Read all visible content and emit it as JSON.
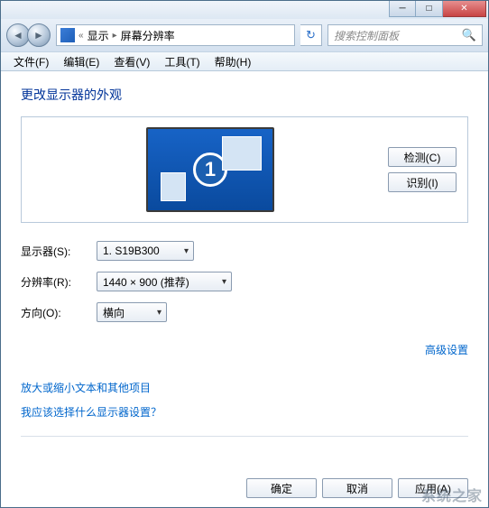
{
  "titlebar": {
    "min": "─",
    "max": "□",
    "close": "✕"
  },
  "nav": {
    "back": "◄",
    "forward": "►",
    "breadcrumb_dbl_chev": "«",
    "breadcrumb_item1": "显示",
    "breadcrumb_item2": "屏幕分辨率",
    "breadcrumb_sep": "▸",
    "refresh": "↻",
    "search_placeholder": "搜索控制面板",
    "search_icon": "🔍"
  },
  "menu": {
    "file": "文件(F)",
    "edit": "编辑(E)",
    "view": "查看(V)",
    "tools": "工具(T)",
    "help": "帮助(H)"
  },
  "page": {
    "title": "更改显示器的外观",
    "monitor_number": "1",
    "detect_btn": "检测(C)",
    "identify_btn": "识别(I)"
  },
  "form": {
    "display_label": "显示器(S):",
    "display_value": "1. S19B300",
    "resolution_label": "分辨率(R):",
    "resolution_value": "1440 × 900 (推荐)",
    "orientation_label": "方向(O):",
    "orientation_value": "横向"
  },
  "links": {
    "advanced": "高级设置",
    "text_size": "放大或缩小文本和其他项目",
    "which_display": "我应该选择什么显示器设置？"
  },
  "buttons": {
    "ok": "确定",
    "cancel": "取消",
    "apply": "应用(A)"
  },
  "watermark": "系统之家"
}
